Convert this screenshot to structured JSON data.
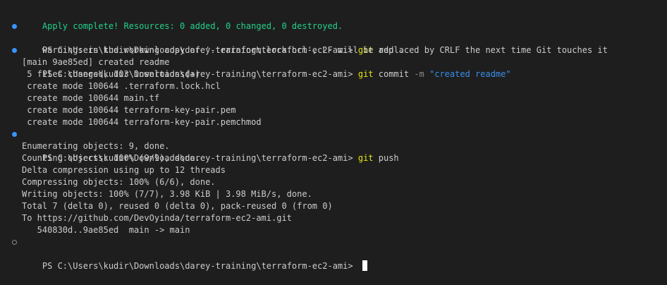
{
  "apply_status": "Apply complete! Resources: 0 added, 0 changed, 0 destroyed.",
  "prompt": "PS C:\\Users\\kudir\\Downloads\\darey-training\\terraform-ec2-ami> ",
  "cmd_add": {
    "git": "git",
    "args": " add ."
  },
  "warning": "warning: in the working copy of '.terraform.lock.hcl', LF will be replaced by CRLF the next time Git touches it",
  "cmd_commit": {
    "git": "git",
    "sub": " commit ",
    "flag": "-m",
    "message": " \"created readme\""
  },
  "commit_output": [
    "[main 9ae85ed] created readme",
    " 5 files changed, 103 insertions(+)",
    " create mode 100644 .terraform.lock.hcl",
    " create mode 100644 main.tf",
    " create mode 100644 terraform-key-pair.pem",
    " create mode 100644 terraform-key-pair.pemchmod"
  ],
  "cmd_push": {
    "git": "git",
    "args": " push"
  },
  "push_output": [
    "Enumerating objects: 9, done.",
    "Counting objects: 100% (9/9), done.",
    "Delta compression using up to 12 threads",
    "Compressing objects: 100% (6/6), done.",
    "Writing objects: 100% (7/7), 3.98 KiB | 3.98 MiB/s, done.",
    "Total 7 (delta 0), reused 0 (delta 0), pack-reused 0 (from 0)",
    "To https://github.com/DevOyinda/terraform-ec2-ami.git",
    "   540830d..9ae85ed  main -> main"
  ],
  "decorations": {
    "success_icon": "filled-circle",
    "pending_icon": "hollow-circle"
  },
  "colors": {
    "background": "#1e1e1e",
    "text": "#cccccc",
    "success": "#23d18b",
    "command": "#e5e510",
    "string": "#3b8eea",
    "decoration": "#3794ff"
  }
}
